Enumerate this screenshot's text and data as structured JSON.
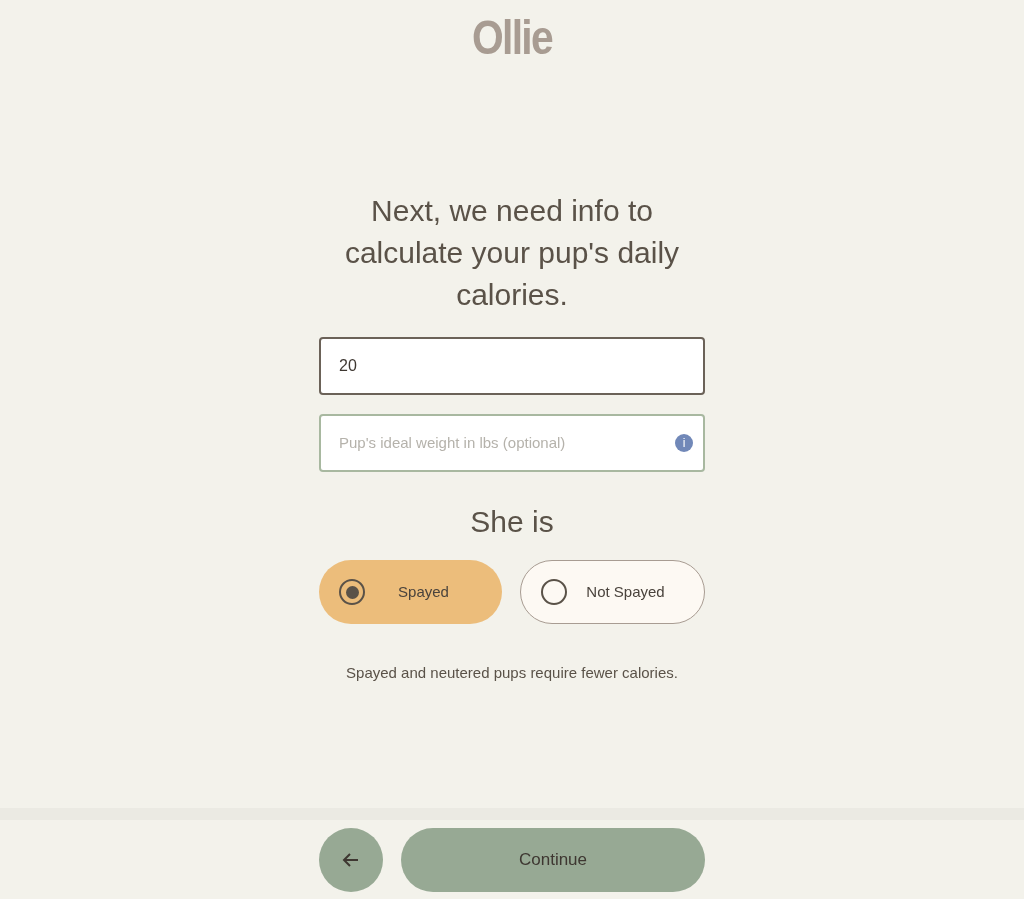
{
  "logo": "Ollie",
  "heading": "Next, we need info to calculate your pup's daily calories.",
  "fields": [
    {
      "value": "20"
    },
    {
      "placeholder": "Pup's ideal weight in lbs (optional)",
      "info": "i"
    }
  ],
  "question": "She is",
  "options": [
    {
      "label": "Spayed",
      "selected": true
    },
    {
      "label": "Not Spayed",
      "selected": false
    }
  ],
  "note": "Spayed and neutered pups require fewer calories.",
  "continue_button": "Continue"
}
